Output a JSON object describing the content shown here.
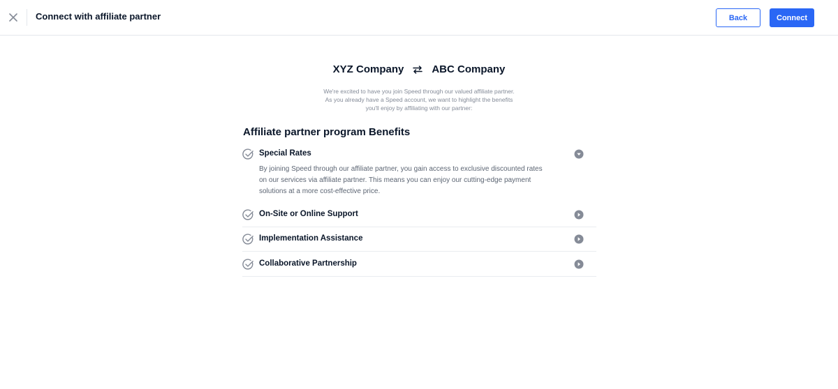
{
  "header": {
    "title": "Connect with affiliate partner",
    "back_label": "Back",
    "connect_label": "Connect"
  },
  "companies": {
    "left": "XYZ Company",
    "right": "ABC Company"
  },
  "intro": {
    "line1": "We're excited to have you join Speed through our valued affiliate partner.",
    "line2": "As you already have a Speed account, we want to highlight the benefits",
    "line3": "you'll enjoy by affiliating with our partner:"
  },
  "benefits": {
    "title": "Affiliate partner program Benefits",
    "items": [
      {
        "label": "Special Rates",
        "expanded": true,
        "desc_lines": [
          "By joining Speed through our affiliate partner, you gain access to exclusive discounted rates",
          "on our services via affiliate partner. This means you can enjoy our cutting-edge payment",
          "solutions at a more cost-effective price."
        ]
      },
      {
        "label": "On-Site or Online Support",
        "expanded": false
      },
      {
        "label": "Implementation Assistance",
        "expanded": false
      },
      {
        "label": "Collaborative Partnership",
        "expanded": false
      }
    ]
  },
  "colors": {
    "accent": "#2a67f5",
    "text": "#0a1629",
    "muted": "#848b98",
    "icon": "#858b97"
  },
  "icons": {
    "close": "close-icon",
    "swap": "swap-arrows-icon",
    "check": "check-circle-icon",
    "expand": "chevron-down-icon",
    "collapsed": "chevron-right-icon"
  }
}
